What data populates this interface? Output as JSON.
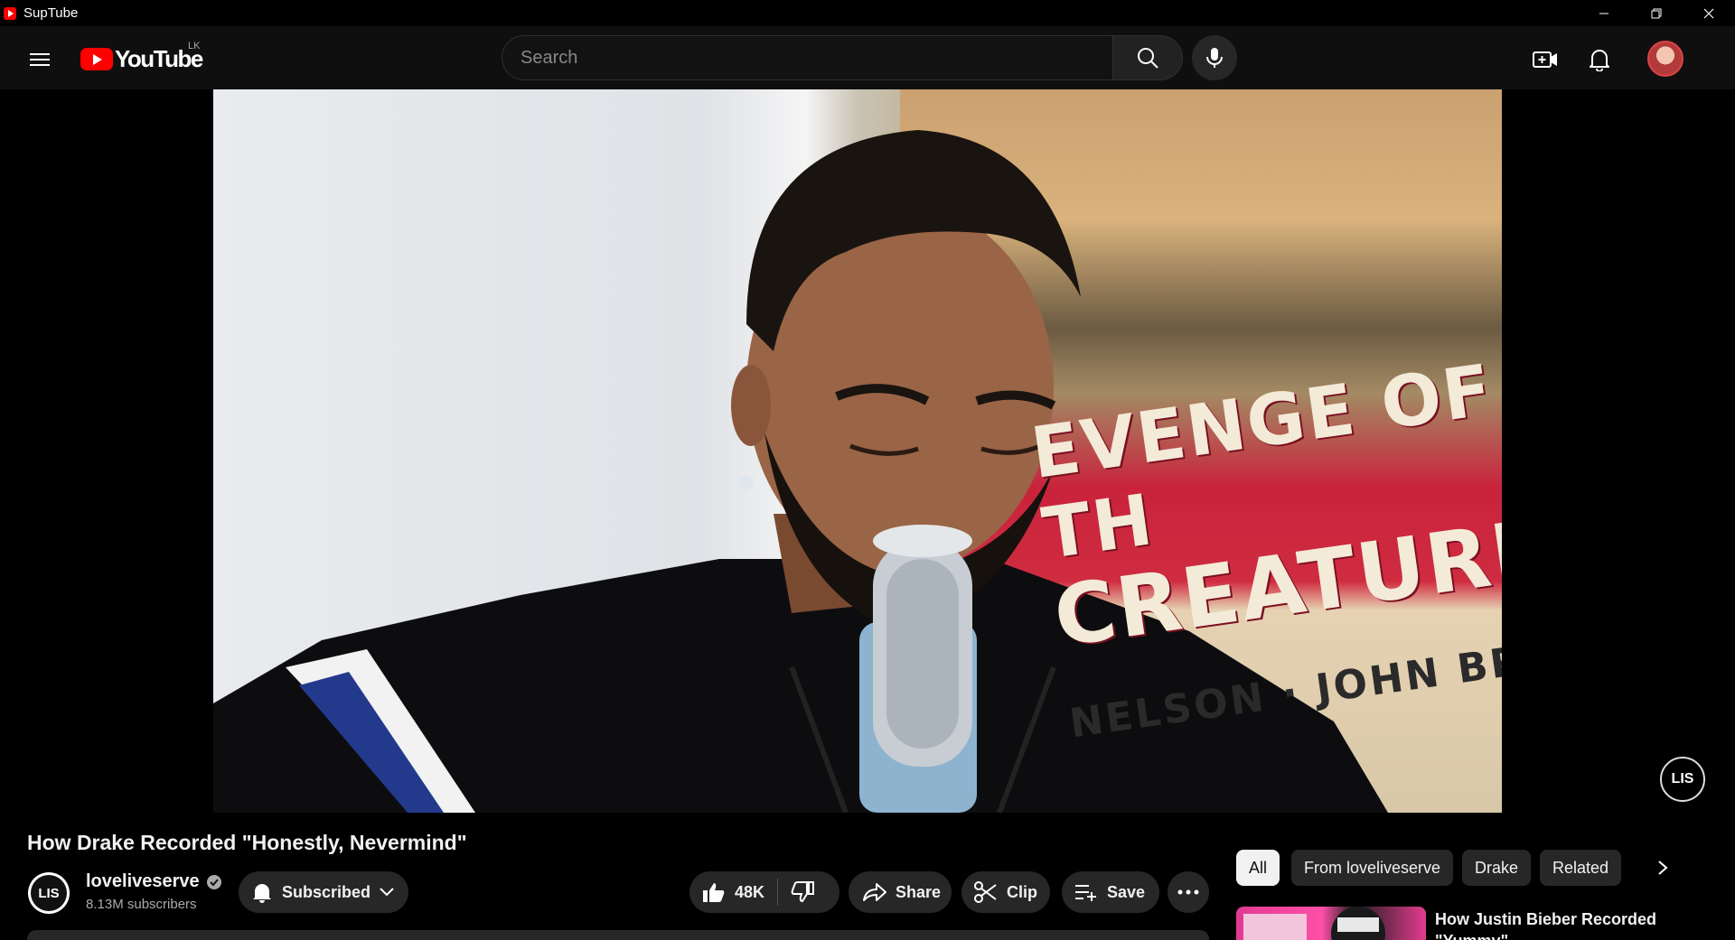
{
  "window": {
    "app_title": "SupTube",
    "controls": {
      "minimize": "–",
      "restore": "❐",
      "close": "✕"
    }
  },
  "header": {
    "logo_text": "YouTube",
    "country_code": "LK",
    "search_placeholder": "Search"
  },
  "video": {
    "title": "How Drake Recorded \"Honestly, Nevermind\"",
    "poster_text": [
      "EVENGE OF TH",
      "CREATURE",
      "NELSON · JOHN BR"
    ],
    "watermark": "LIS"
  },
  "channel": {
    "name": "loveliveserve",
    "avatar_text": "LIS",
    "subscribers": "8.13M subscribers",
    "subscribe_label": "Subscribed"
  },
  "actions": {
    "like_count": "48K",
    "share_label": "Share",
    "clip_label": "Clip",
    "save_label": "Save"
  },
  "chips": [
    {
      "label": "All",
      "active": true
    },
    {
      "label": "From loveliveserve",
      "active": false
    },
    {
      "label": "Drake",
      "active": false
    },
    {
      "label": "Related",
      "active": false
    }
  ],
  "recommended": [
    {
      "title": "How Justin Bieber Recorded \"Yummy\""
    }
  ],
  "colors": {
    "background": "#0f0f0f",
    "surface": "#272727",
    "brand_red": "#ff0000",
    "text_primary": "#f1f1f1",
    "text_secondary": "#aaaaaa"
  }
}
